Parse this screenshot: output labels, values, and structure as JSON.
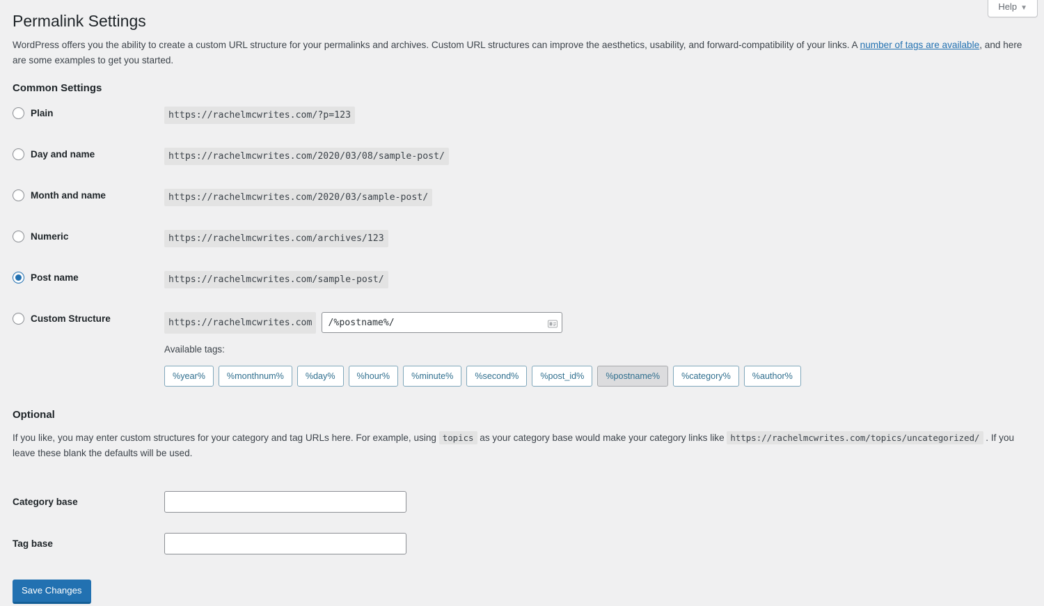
{
  "header": {
    "title": "Permalink Settings",
    "help_label": "Help",
    "help_caret": "▼"
  },
  "intro": {
    "part1": "WordPress offers you the ability to create a custom URL structure for your permalinks and archives. Custom URL structures can improve the aesthetics, usability, and forward-compatibility of your links. A ",
    "link_text": "number of tags are available",
    "part2": ", and here are some examples to get you started."
  },
  "common_settings": {
    "heading": "Common Settings",
    "options": [
      {
        "label": "Plain",
        "example": "https://rachelmcwrites.com/?p=123",
        "selected": false
      },
      {
        "label": "Day and name",
        "example": "https://rachelmcwrites.com/2020/03/08/sample-post/",
        "selected": false
      },
      {
        "label": "Month and name",
        "example": "https://rachelmcwrites.com/2020/03/sample-post/",
        "selected": false
      },
      {
        "label": "Numeric",
        "example": "https://rachelmcwrites.com/archives/123",
        "selected": false
      },
      {
        "label": "Post name",
        "example": "https://rachelmcwrites.com/sample-post/",
        "selected": true
      }
    ],
    "custom": {
      "label": "Custom Structure",
      "url_prefix": "https://rachelmcwrites.com",
      "input_value": "/%postname%/",
      "input_placeholder": "",
      "autofill_icon": "form-autofill-icon",
      "available_tags_label": "Available tags:",
      "tags": [
        {
          "label": "%year%",
          "used": false
        },
        {
          "label": "%monthnum%",
          "used": false
        },
        {
          "label": "%day%",
          "used": false
        },
        {
          "label": "%hour%",
          "used": false
        },
        {
          "label": "%minute%",
          "used": false
        },
        {
          "label": "%second%",
          "used": false
        },
        {
          "label": "%post_id%",
          "used": false
        },
        {
          "label": "%postname%",
          "used": true
        },
        {
          "label": "%category%",
          "used": false
        },
        {
          "label": "%author%",
          "used": false
        }
      ]
    }
  },
  "optional": {
    "heading": "Optional",
    "desc_part1": "If you like, you may enter custom structures for your category and tag URLs here. For example, using ",
    "desc_code1": "topics",
    "desc_part2": " as your category base would make your category links like ",
    "desc_code2": "https://rachelmcwrites.com/topics/uncategorized/",
    "desc_part3": " . If you leave these blank the defaults will be used.",
    "category_base": {
      "label": "Category base",
      "value": "",
      "placeholder": ""
    },
    "tag_base": {
      "label": "Tag base",
      "value": "",
      "placeholder": ""
    }
  },
  "actions": {
    "save_label": "Save Changes"
  },
  "colors": {
    "accent": "#2271b1",
    "accent_dark": "#135e96",
    "page_bg": "#f0f0f1",
    "code_bg": "#e3e3e3",
    "tag_border": "#7fa7bb",
    "tag_text": "#2e6e8e",
    "tag_used_bg": "#dcdcde"
  }
}
